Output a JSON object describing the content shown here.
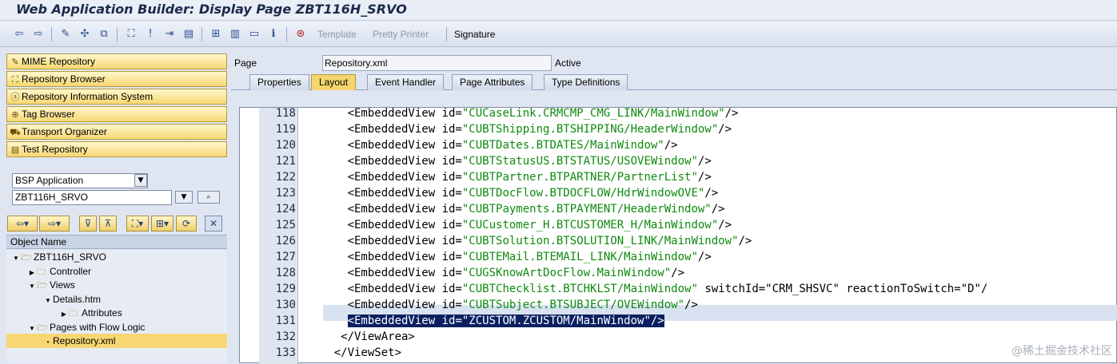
{
  "window": {
    "title": "Web Application Builder: Display Page ZBT116H_SRVO"
  },
  "toolbar": {
    "buttons": [
      {
        "icon": "back-arrow-icon",
        "glyph": "⇦"
      },
      {
        "icon": "forward-arrow-icon",
        "glyph": "⇨"
      },
      {
        "icon": "display-change-icon",
        "glyph": "✎"
      },
      {
        "icon": "activate-icon",
        "glyph": "✣"
      },
      {
        "icon": "other-object-icon",
        "glyph": "⧉"
      },
      {
        "icon": "hierarchy-icon",
        "glyph": "⛶"
      },
      {
        "icon": "where-used-icon",
        "glyph": "ǃ"
      },
      {
        "icon": "navigation-icon",
        "glyph": "⇥"
      },
      {
        "icon": "display-object-list-icon",
        "glyph": "▤"
      },
      {
        "icon": "object-list-icon",
        "glyph": "⊞"
      },
      {
        "icon": "pattern-icon",
        "glyph": "▥"
      },
      {
        "icon": "layout-icon",
        "glyph": "▭"
      },
      {
        "icon": "info-icon",
        "glyph": "ℹ"
      },
      {
        "icon": "test-icon",
        "glyph": "⊛"
      }
    ],
    "template_label": "Template",
    "pretty_printer_label": "Pretty Printer",
    "signature_label": "Signature"
  },
  "nav": [
    {
      "label": "MIME Repository",
      "icon": "mime-repository-icon"
    },
    {
      "label": "Repository Browser",
      "icon": "repository-browser-icon"
    },
    {
      "label": "Repository Information System",
      "icon": "repository-info-icon"
    },
    {
      "label": "Tag Browser",
      "icon": "tag-browser-icon"
    },
    {
      "label": "Transport Organizer",
      "icon": "transport-icon"
    },
    {
      "label": "Test Repository",
      "icon": "test-repository-icon"
    }
  ],
  "object_type": {
    "value": "BSP Application"
  },
  "object_name": {
    "value": "ZBT116H_SRVO"
  },
  "tree": {
    "header": "Object Name",
    "nodes": [
      {
        "label": "ZBT116H_SRVO",
        "expanded": true
      },
      {
        "label": "Controller",
        "expanded": false
      },
      {
        "label": "Views",
        "expanded": true
      },
      {
        "label": "Details.htm",
        "expanded": true
      },
      {
        "label": "Attributes",
        "expanded": false
      },
      {
        "label": "Pages with Flow Logic",
        "expanded": true
      },
      {
        "label": "Repository.xml",
        "selected": true
      }
    ]
  },
  "page": {
    "label": "Page",
    "value": "Repository.xml",
    "status": "Active"
  },
  "tabs": [
    "Properties",
    "Layout",
    "Event Handler",
    "Page Attributes",
    "Type Definitions"
  ],
  "active_tab": "Layout",
  "code_lines": [
    {
      "n": "118",
      "pre": "      <EmbeddedView id=",
      "str": "\"CUCaseLink.CRMCMP_CMG_LINK/MainWindow\"",
      "post": "/>"
    },
    {
      "n": "119",
      "pre": "      <EmbeddedView id=",
      "str": "\"CUBTShipping.BTSHIPPING/HeaderWindow\"",
      "post": "/>"
    },
    {
      "n": "120",
      "pre": "      <EmbeddedView id=",
      "str": "\"CUBTDates.BTDATES/MainWindow\"",
      "post": "/>"
    },
    {
      "n": "121",
      "pre": "      <EmbeddedView id=",
      "str": "\"CUBTStatusUS.BTSTATUS/USOVEWindow\"",
      "post": "/>"
    },
    {
      "n": "122",
      "pre": "      <EmbeddedView id=",
      "str": "\"CUBTPartner.BTPARTNER/PartnerList\"",
      "post": "/>"
    },
    {
      "n": "123",
      "pre": "      <EmbeddedView id=",
      "str": "\"CUBTDocFlow.BTDOCFLOW/HdrWindowOVE\"",
      "post": "/>"
    },
    {
      "n": "124",
      "pre": "      <EmbeddedView id=",
      "str": "\"CUBTPayments.BTPAYMENT/HeaderWindow\"",
      "post": "/>"
    },
    {
      "n": "125",
      "pre": "      <EmbeddedView id=",
      "str": "\"CUCustomer_H.BTCUSTOMER_H/MainWindow\"",
      "post": "/>"
    },
    {
      "n": "126",
      "pre": "      <EmbeddedView id=",
      "str": "\"CUBTSolution.BTSOLUTION_LINK/MainWindow\"",
      "post": "/>"
    },
    {
      "n": "127",
      "pre": "      <EmbeddedView id=",
      "str": "\"CUBTEMail.BTEMAIL_LINK/MainWindow\"",
      "post": "/>"
    },
    {
      "n": "128",
      "pre": "      <EmbeddedView id=",
      "str": "\"CUGSKnowArtDocFlow.MainWindow\"",
      "post": "/>"
    },
    {
      "n": "129",
      "pre": "      <EmbeddedView id=",
      "str": "\"CUBTChecklist.BTCHKLST/MainWindow\"",
      "post": " switchId=\"CRM_SHSVC\" reactionToSwitch=\"D\"/"
    },
    {
      "n": "130",
      "pre": "      <EmbeddedView id=",
      "str": "\"CUBTSubject.BTSUBJECT/OVEWindow\"",
      "post": "/>"
    },
    {
      "n": "131",
      "pre": "      ",
      "sel": "<EmbeddedView id=\"ZCUSTOM.ZCUSTOM/MainWindow\"/>",
      "post": ""
    },
    {
      "n": "132",
      "pre": "     </ViewArea>",
      "str": "",
      "post": ""
    },
    {
      "n": "133",
      "pre": "    </ViewSet>",
      "str": "",
      "post": ""
    }
  ],
  "watermark": "@稀土掘金技术社区"
}
